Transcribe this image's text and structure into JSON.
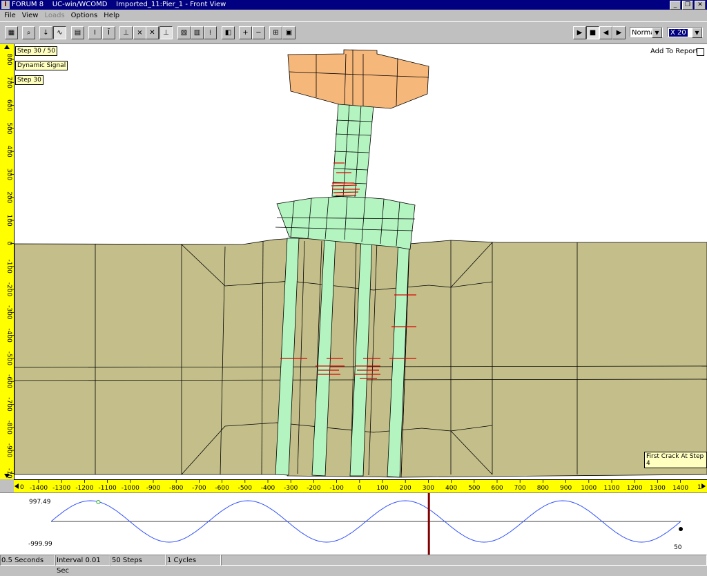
{
  "titlebar": {
    "app_name": "FORUM 8",
    "product": "UC-win/WCOMD",
    "document": "Imported_11:Pier_1 - Front View"
  },
  "menu": [
    {
      "label": "File",
      "enabled": true
    },
    {
      "label": "View",
      "enabled": true
    },
    {
      "label": "Loads",
      "enabled": false
    },
    {
      "label": "Options",
      "enabled": true
    },
    {
      "label": "Help",
      "enabled": true
    }
  ],
  "toolbar": {
    "speed_value": "Normal",
    "scale_value": "X 20"
  },
  "view": {
    "step_label": "Step 30 / 50",
    "signal_label": "Dynamic Signal",
    "step_short": "Step 30",
    "add_to_report": "Add To Report",
    "first_crack": "First Crack At Step 4"
  },
  "ruler": {
    "vertical_ticks": [
      "800",
      "700",
      "600",
      "500",
      "400",
      "300",
      "200",
      "100",
      "0",
      "-100",
      "-200",
      "-300",
      "-400",
      "-500",
      "-600",
      "-700",
      "-800",
      "-900",
      "-10"
    ],
    "horizontal_ticks": [
      "-1400",
      "-1300",
      "-1200",
      "-1100",
      "-1000",
      "-900",
      "-800",
      "-700",
      "-600",
      "-500",
      "-400",
      "-300",
      "-200",
      "-100",
      "0",
      "100",
      "200",
      "300",
      "400",
      "500",
      "600",
      "700",
      "800",
      "900",
      "1000",
      "1100",
      "1200",
      "1300",
      "1400"
    ],
    "h_left_label": "0",
    "h_right_label": "1"
  },
  "signal_graph": {
    "max_label": "997.49",
    "min_label": "-999.99",
    "end_label": "50",
    "total_steps": 50,
    "current_step": 30,
    "cycles": 4
  },
  "status": [
    "0.5 Seconds",
    "Interval 0.01 Sec",
    "50 Steps",
    "1 Cycles",
    ""
  ],
  "colors": {
    "soil": "#c4bf8a",
    "pile": "#b4f4c0",
    "cap": "#f6b77a",
    "crack": "#e00000",
    "ruler": "#ffff00",
    "signal": "#3050ff",
    "marker": "#800000",
    "titlebar": "#000080"
  }
}
